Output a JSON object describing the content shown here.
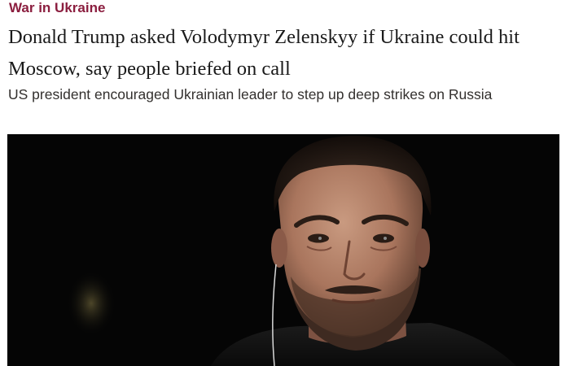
{
  "article": {
    "topic": "War in Ukraine",
    "headline": "Donald Trump asked Volodymyr Zelenskyy if Ukraine could hit Moscow, say people briefed on call",
    "standfirst": "US president encouraged Ukrainian leader to step up deep strikes on Russia"
  },
  "image": {
    "subject": "portrait of man in dark clothing against black background"
  },
  "colors": {
    "topic": "#8b1e3f",
    "headline": "#1a1a1a",
    "standfirst": "#33302e",
    "image_background": "#050505"
  }
}
